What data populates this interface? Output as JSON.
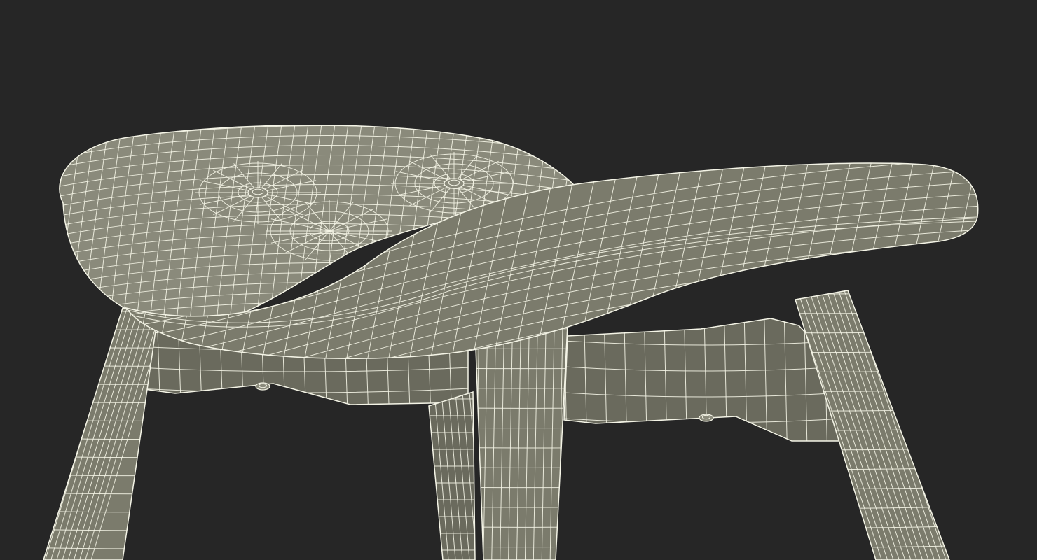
{
  "scene": {
    "subject": "stool-wireframe-render",
    "colors": {
      "background": "#262626",
      "surface": "#7b7b6c",
      "surface_shadow": "#6a6a5d",
      "surface_light": "#8a8a7b",
      "wire": "#f4f4e6"
    }
  }
}
